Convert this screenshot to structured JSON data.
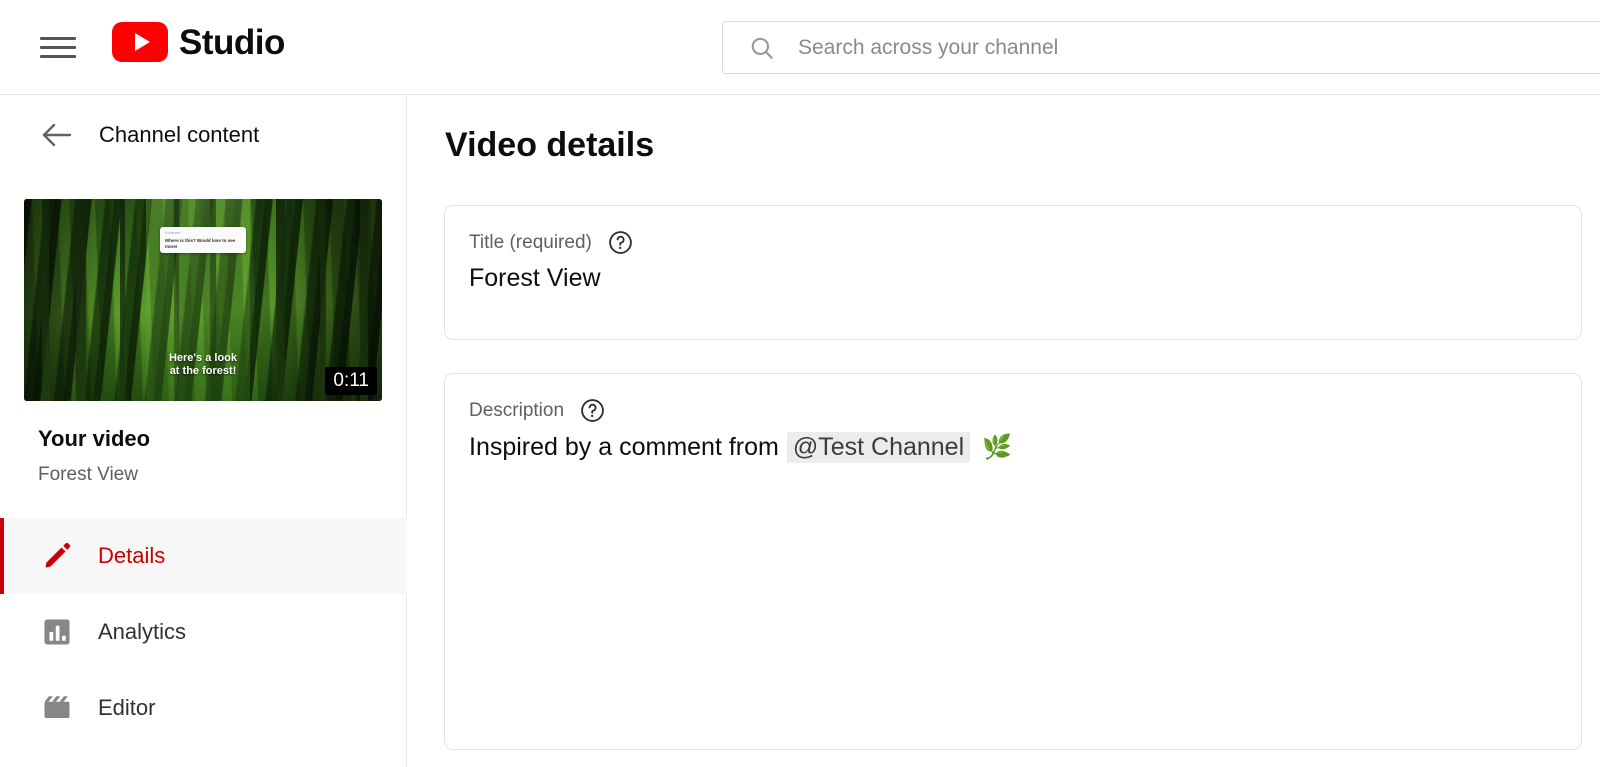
{
  "topbar": {
    "menu_icon": "hamburger-menu-icon",
    "brand_icon": "youtube-play-logo-icon",
    "brand_text": "Studio",
    "search": {
      "icon": "search-icon",
      "placeholder": "Search across your channel",
      "value": ""
    }
  },
  "sidebar": {
    "back_icon": "back-arrow-icon",
    "header_label": "Channel content",
    "thumbnail": {
      "comment_card_header": "Comment",
      "comment_card_body": "Where is this? Would love to see more!",
      "caption_line1": "Here's a look",
      "caption_line2": "at the forest!",
      "duration": "0:11"
    },
    "video": {
      "heading": "Your video",
      "title": "Forest View"
    },
    "nav_items": [
      {
        "label": "Details",
        "icon": "pencil-icon",
        "active": true
      },
      {
        "label": "Analytics",
        "icon": "bar-chart-icon",
        "active": false
      },
      {
        "label": "Editor",
        "icon": "clapperboard-icon",
        "active": false
      }
    ]
  },
  "main": {
    "page_title": "Video details",
    "title_field": {
      "label": "Title (required)",
      "help_icon": "help-circle-icon",
      "value": "Forest View"
    },
    "description_field": {
      "label": "Description",
      "help_icon": "help-circle-icon",
      "text_prefix": "Inspired by a comment from",
      "mention": "@Test Channel",
      "emoji": "🌿"
    }
  },
  "colors": {
    "brand_red": "#ff0000",
    "active_red": "#cc0000",
    "text_primary": "#0d0d0d",
    "text_secondary": "#606060",
    "border": "#e2e2e2"
  }
}
